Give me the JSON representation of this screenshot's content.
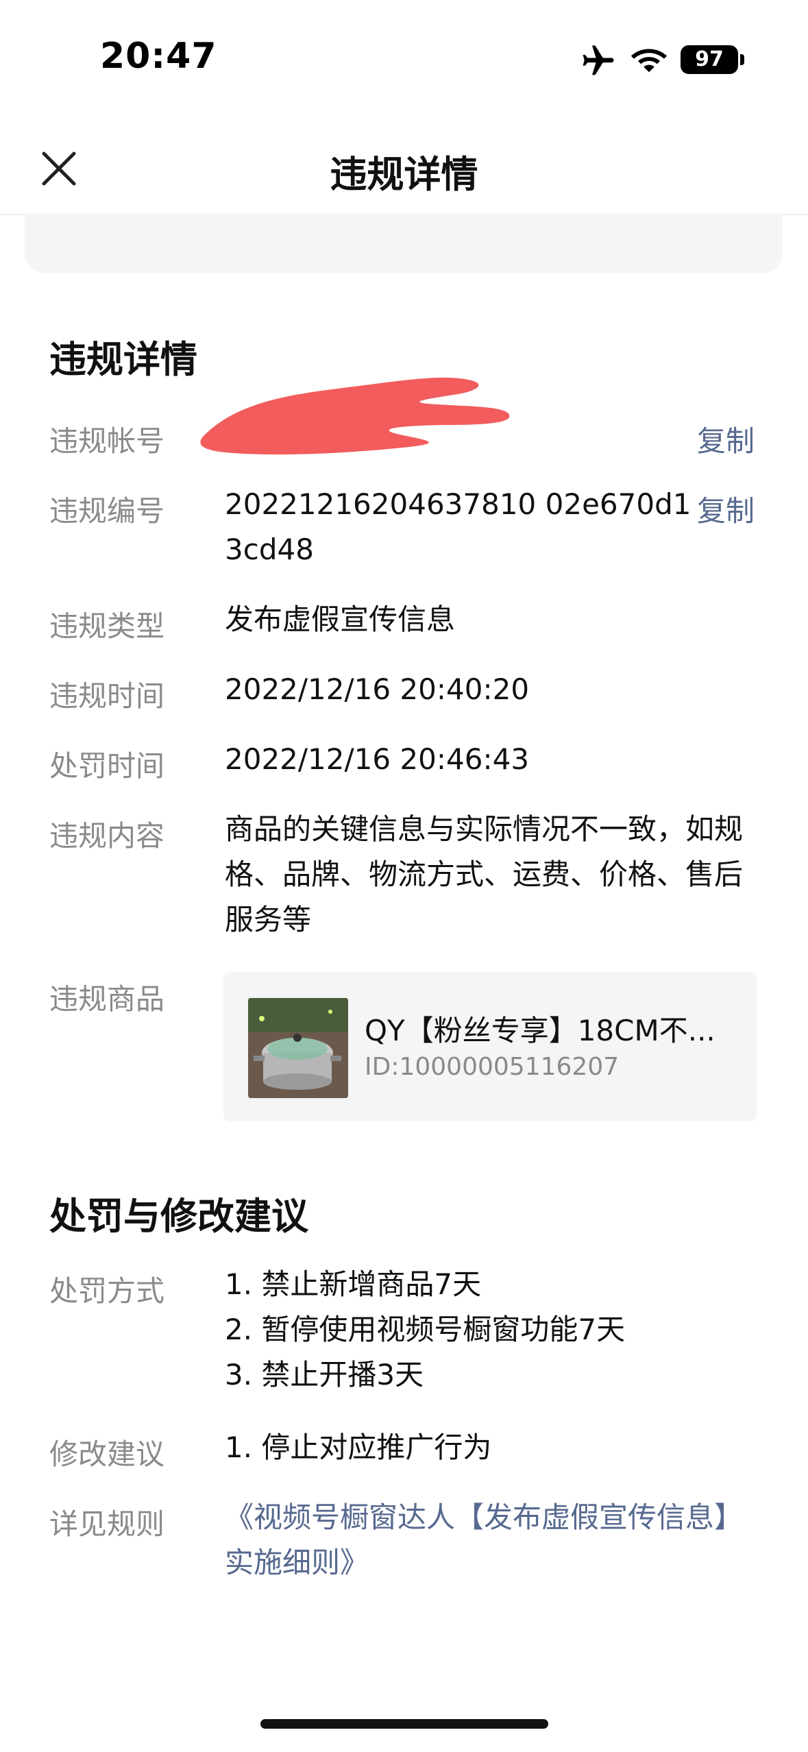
{
  "status_bar": {
    "time": "20:47",
    "battery": "97",
    "icons": [
      "airplane-icon",
      "wifi-icon",
      "battery-icon"
    ]
  },
  "nav": {
    "title": "违规详情",
    "close_icon": "close-icon"
  },
  "violation": {
    "section_title": "违规详情",
    "copy_label": "复制",
    "account_label": "违规帐号",
    "number_label": "违规编号",
    "number_value": "20221216204637810 02e670d13cd48",
    "type_label": "违规类型",
    "type_value": "发布虚假宣传信息",
    "time_label": "违规时间",
    "time_value": "2022/12/16 20:40:20",
    "penalty_time_label": "处罚时间",
    "penalty_time_value": "2022/12/16 20:46:43",
    "content_label": "违规内容",
    "content_value": "商品的关键信息与实际情况不一致，如规格、品牌、物流方式、运费、价格、售后服务等",
    "product_label": "违规商品",
    "product": {
      "name": "QY【粉丝专享】18CM不...",
      "id": "ID:10000005116207"
    }
  },
  "penalty": {
    "section_title": "处罚与修改建议",
    "method_label": "处罚方式",
    "methods": [
      "1. 禁止新增商品7天",
      "2. 暂停使用视频号橱窗功能7天",
      "3. 禁止开播3天"
    ],
    "suggestion_label": "修改建议",
    "suggestion_value": "1. 停止对应推广行为",
    "rule_label": "详见规则",
    "rule_link": "《视频号橱窗达人【发布虚假宣传信息】实施细则》"
  },
  "colors": {
    "link": "#57698f",
    "label": "#8a8a8a",
    "card": "#f5f5f5",
    "redaction": "#f25c5c"
  }
}
